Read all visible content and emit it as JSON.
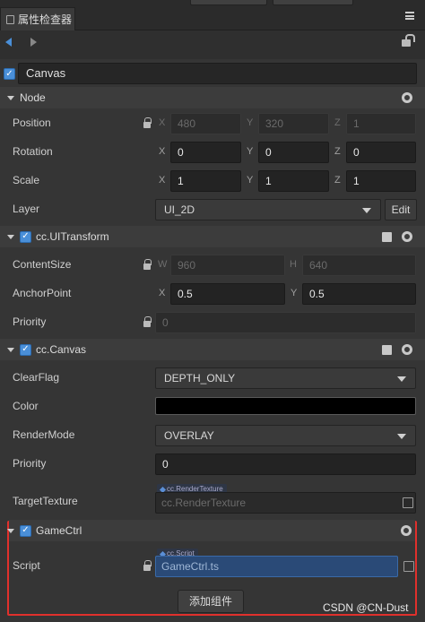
{
  "panel": {
    "title": "属性检查器"
  },
  "node_name": "Canvas",
  "sections": {
    "node": {
      "title": "Node"
    },
    "uitransform": {
      "title": "cc.UITransform"
    },
    "canvas": {
      "title": "cc.Canvas"
    },
    "gamectrl": {
      "title": "GameCtrl"
    }
  },
  "node_props": {
    "position": {
      "label": "Position",
      "x_axis": "X",
      "x": "480",
      "y_axis": "Y",
      "y": "320",
      "z_axis": "Z",
      "z": "1"
    },
    "rotation": {
      "label": "Rotation",
      "x_axis": "X",
      "x": "0",
      "y_axis": "Y",
      "y": "0",
      "z_axis": "Z",
      "z": "0"
    },
    "scale": {
      "label": "Scale",
      "x_axis": "X",
      "x": "1",
      "y_axis": "Y",
      "y": "1",
      "z_axis": "Z",
      "z": "1"
    },
    "layer": {
      "label": "Layer",
      "value": "UI_2D",
      "edit_label": "Edit"
    }
  },
  "uitransform_props": {
    "content_size": {
      "label": "ContentSize",
      "w_axis": "W",
      "w": "960",
      "h_axis": "H",
      "h": "640"
    },
    "anchor_point": {
      "label": "AnchorPoint",
      "x_axis": "X",
      "x": "0.5",
      "y_axis": "Y",
      "y": "0.5"
    },
    "priority": {
      "label": "Priority",
      "value": "0"
    }
  },
  "canvas_props": {
    "clear_flag": {
      "label": "ClearFlag",
      "value": "DEPTH_ONLY"
    },
    "color": {
      "label": "Color",
      "value": "#000000"
    },
    "render_mode": {
      "label": "RenderMode",
      "value": "OVERLAY"
    },
    "priority": {
      "label": "Priority",
      "value": "0"
    },
    "target_texture": {
      "label": "TargetTexture",
      "tag": "cc.RenderTexture",
      "placeholder": "cc.RenderTexture"
    }
  },
  "gamectrl_props": {
    "script": {
      "label": "Script",
      "tag": "cc.Script",
      "value": "GameCtrl.ts"
    }
  },
  "add_component_label": "添加组件",
  "watermark": "CSDN @CN-Dust",
  "colors": {
    "accent": "#4a8fd8",
    "highlight": "#e0302c",
    "background": "#353535"
  }
}
